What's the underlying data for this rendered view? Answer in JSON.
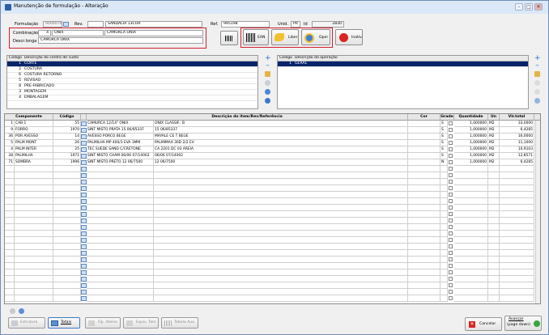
{
  "window": {
    "title": "Manutenção de formulação - Alteração",
    "controls": {
      "minimize": "–",
      "maximize": "□",
      "close": "✕"
    }
  },
  "header": {
    "formulacao_label": "Formulação",
    "formulacao_value": "9000070",
    "rev_label": "Rev.",
    "rev_value": "",
    "product_name": "SANDALIA 13COR",
    "ref_label": "Ref.",
    "ref_value": "995198",
    "unid_label": "Unid.",
    "unid_value": "PR",
    "id_label": "Id",
    "id_value": "2830"
  },
  "combination": {
    "label": "Combinação",
    "code": "4",
    "name": "ONIX",
    "color": "CAMURCA ONIX",
    "desc_label": "Descr.longa",
    "desc_value": "CAMURCA ONIX"
  },
  "toolbar": {
    "ean_label": "EAN",
    "liber_label": "Liber",
    "oper_label": "Oper",
    "inativ_label": "Inativ"
  },
  "cost_centers": {
    "col_code": "Código",
    "col_desc": "Descrição do centro de custo",
    "rows": [
      {
        "code": "1",
        "desc": "CORTE"
      },
      {
        "code": "2",
        "desc": "COSTURA"
      },
      {
        "code": "6",
        "desc": "COSTURA RETORNO"
      },
      {
        "code": "5",
        "desc": "REVISAO"
      },
      {
        "code": "8",
        "desc": "PRE-FABRICADO"
      },
      {
        "code": "3",
        "desc": "MONTAGEM"
      },
      {
        "code": "4",
        "desc": "EMBALAGEM"
      }
    ]
  },
  "operations": {
    "col_code": "Código",
    "col_desc": "Descrição da operação",
    "rows": [
      {
        "code": "1",
        "desc": "GERAL"
      }
    ]
  },
  "items": {
    "columns": {
      "componente": "Componente",
      "codigo": "Código",
      "descricao": "Descrição do item/Rev/Referência",
      "cor": "Cor",
      "grade": "Grade",
      "quantidade": "Quantidade",
      "un": "Un",
      "vlr_total": "Vlr.total"
    },
    "rows": [
      {
        "seq": "1",
        "comp": "CAB 1",
        "code": "55",
        "desc": "CAMURCA 12/14\" ONIX",
        "desc2": "ONIX CLASSIF.: B",
        "cor": "",
        "grade": "S",
        "qty": "1,000000",
        "un": "M2",
        "total": "33,0000"
      },
      {
        "seq": "9",
        "comp": "FORRO",
        "code": "1970",
        "desc": "SINT MISTO PRATA 15 06/85337",
        "desc2": "15 06/85337",
        "cor": "",
        "grade": "S",
        "qty": "1,000000",
        "un": "M2",
        "total": "6,4285"
      },
      {
        "seq": "36",
        "comp": "POR AVESSO",
        "code": "14",
        "desc": "AVESSO PORCO BEGE",
        "desc2": "MAYALE CE T BEGE",
        "cor": "",
        "grade": "S",
        "qty": "1,000000",
        "un": "M2",
        "total": "16,0000"
      },
      {
        "seq": "5",
        "comp": "PALM MONT",
        "code": "26",
        "desc": "PALMILHA MP 400/3 EVA 3MM",
        "desc2": "PALMIMAX 30D 2/2 EV",
        "cor": "",
        "grade": "S",
        "qty": "1,000000",
        "un": "M2",
        "total": "11,1000"
      },
      {
        "seq": "4",
        "comp": "PALM INTER",
        "code": "25",
        "desc": "TEC SUEDE SAND C/CRETONE",
        "desc2": "CA 2201 DC 03 AREIA",
        "cor": "",
        "grade": "S",
        "qty": "1,000000",
        "un": "M2",
        "total": "10,9103"
      },
      {
        "seq": "38",
        "comp": "PALMILHA",
        "code": "1971",
        "desc": "SINT MISTO CHAM 06/06 07/14002",
        "desc2": "06/06 07/14002",
        "cor": "",
        "grade": "S",
        "qty": "1,000000",
        "un": "M2",
        "total": "12,8571"
      },
      {
        "seq": "71",
        "comp": "SOMBRA",
        "code": "1996",
        "desc": "SINT MISTO PRETO 12 06/7500",
        "desc2": "12 06/7500",
        "cor": "",
        "grade": "N",
        "qty": "1,000000",
        "un": "M2",
        "total": "6,4285"
      }
    ]
  },
  "footer": {
    "estrutura": "Estrutura",
    "totais": "Totais",
    "op_atelier": "Op. Atelier",
    "equiv_tam": "Equiv. Tam",
    "tabela_aux": "Tabela Aux.",
    "cancelar": "Cancelar",
    "avancar": "Avançar",
    "avancar_sub": "(page down)"
  }
}
